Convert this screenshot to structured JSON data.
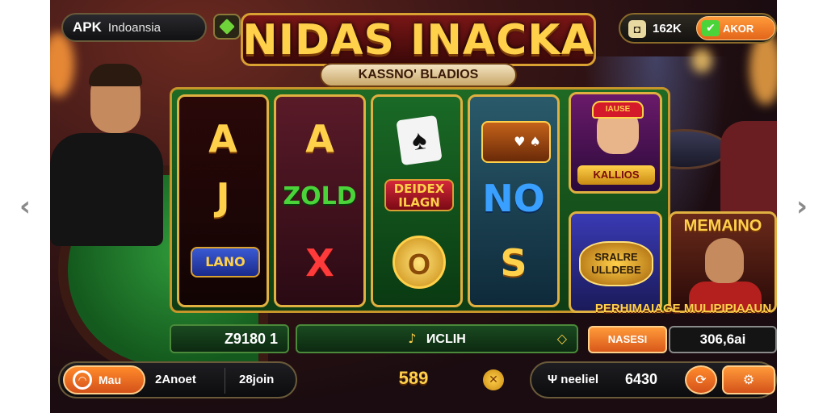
{
  "top_bar": {
    "apk_label": "APK",
    "region_label": "Indoansia",
    "coins_value": "162K",
    "buy_label": "AKOR"
  },
  "title": {
    "main": "NIDAS INACKA",
    "subtitle": "KASSNO' BLADIOS"
  },
  "reels": [
    {
      "symbols": [
        "A",
        "J",
        "LANO"
      ]
    },
    {
      "symbols": [
        "A",
        "ZOLD",
        "X"
      ]
    },
    {
      "symbols": [
        "♠",
        "DEIDEX ILAGN",
        "O"
      ]
    },
    {
      "symbols": [
        "♥ ♠",
        "NO",
        "S"
      ]
    }
  ],
  "side_tiles": {
    "tile_top_label": "KALLIOS",
    "tile_top_badge": "IAUSE",
    "tile_bottom_label": "SRALRE ULLDEBE"
  },
  "promo": {
    "title": "MEMAINO",
    "caption": "PERHIMAIAGE MULIPIPIAAUN"
  },
  "info_bar": {
    "win_value": "Z9180 1",
    "message": "ИCLIH",
    "action_label": "NASESI",
    "balance_value": "306,6ai"
  },
  "bottom_bar": {
    "menu_label": "Mau",
    "mode_label": "2Anoet",
    "join_label": "28join",
    "bet_value": "589",
    "model_label": "Ψ neeliel",
    "credit_value": "6430"
  },
  "colors": {
    "accent_gold": "#ffd04a",
    "accent_orange": "#ff8a2a",
    "felt_green": "#1e6a24"
  }
}
